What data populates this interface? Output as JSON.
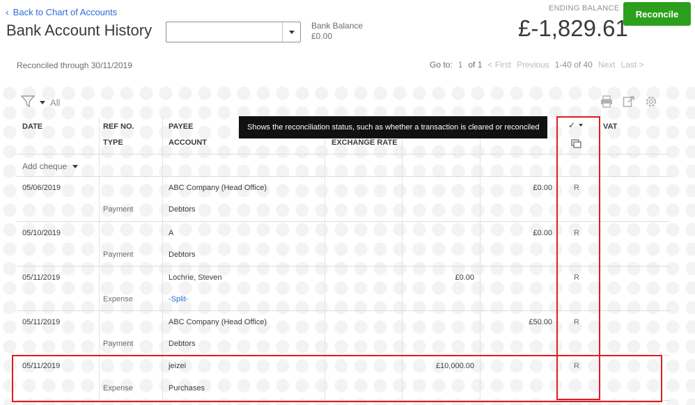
{
  "header": {
    "back_link": "Back to Chart of Accounts",
    "title": "Bank Account History",
    "account_select_value": "",
    "bank_balance_label": "Bank Balance",
    "bank_balance_value": "£0.00",
    "ending_balance_label": "ENDING BALANCE",
    "ending_balance_value": "£-1,829.61",
    "reconcile_button": "Reconcile"
  },
  "subbar": {
    "reconciled_through": "Reconciled through 30/11/2019",
    "goto_label": "Go to:",
    "page_current": "1",
    "page_of": "of 1",
    "first": "< First",
    "previous": "Previous",
    "range": "1-40 of 40",
    "next": "Next",
    "last": "Last >"
  },
  "filter": {
    "label": "All"
  },
  "tooltip": "Shows the reconciliation status, such as whether a transaction is cleared or reconciled",
  "columns": {
    "date": "DATE",
    "ref_no": "REF NO.",
    "type": "TYPE",
    "payee": "PAYEE",
    "account": "ACCOUNT",
    "exchange_rate": "EXCHANGE RATE",
    "vat": "VAT"
  },
  "add_cheque": "Add cheque",
  "rows": [
    {
      "date": "05/06/2019",
      "type": "Payment",
      "payee": "ABC Company (Head Office)",
      "account": "Debtors",
      "payment": "",
      "deposit": "£0.00",
      "status": "R"
    },
    {
      "date": "05/10/2019",
      "type": "Payment",
      "payee": "A",
      "account": "Debtors",
      "payment": "",
      "deposit": "£0.00",
      "status": "R"
    },
    {
      "date": "05/11/2019",
      "type": "Expense",
      "payee": "Lochrie, Steven",
      "account": "-Split-",
      "payment": "£0.00",
      "deposit": "",
      "status": "R"
    },
    {
      "date": "05/11/2019",
      "type": "Payment",
      "payee": "ABC Company (Head Office)",
      "account": "Debtors",
      "payment": "",
      "deposit": "£50.00",
      "status": "R"
    },
    {
      "date": "05/11/2019",
      "type": "Expense",
      "payee": "jeizei",
      "account": "Purchases",
      "payment": "£10,000.00",
      "deposit": "",
      "status": "R"
    }
  ],
  "colors": {
    "accent_green": "#2ca01c",
    "link_blue": "#2b6ed9",
    "highlight_red": "#e01a22"
  },
  "icons": [
    "chevron-left-icon",
    "filter-icon",
    "print-icon",
    "export-icon",
    "gear-icon",
    "checkmark-icon",
    "copy-icon"
  ]
}
